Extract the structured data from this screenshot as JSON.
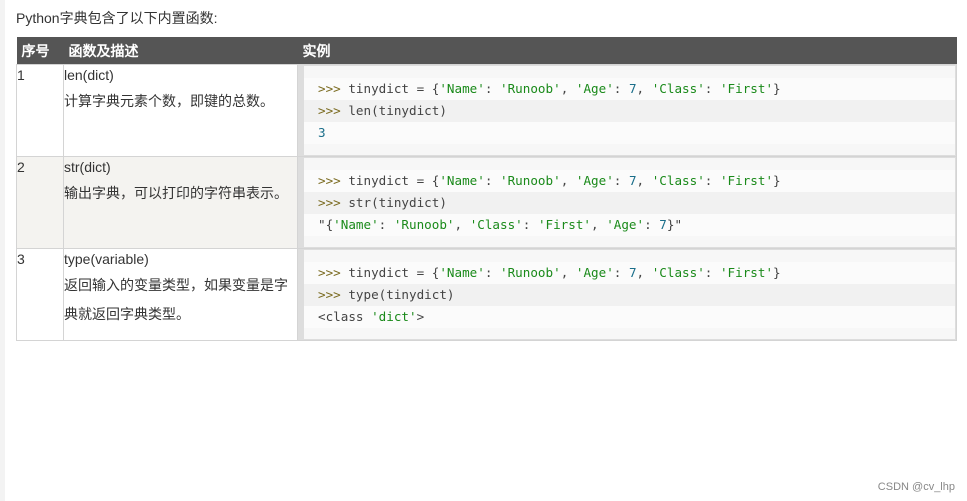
{
  "intro": "Python字典包含了以下内置函数:",
  "table": {
    "headers": [
      "序号",
      "函数及描述",
      "实例"
    ],
    "rows": [
      {
        "num": "1",
        "func": "len(dict)",
        "desc": "计算字典元素个数，即键的总数。",
        "code": [
          {
            "prompt": ">>> ",
            "code": "tinydict = {'Name': 'Runoob', 'Age': 7, 'Class': 'First'}"
          },
          {
            "prompt": ">>> ",
            "code": "len(tinydict)"
          },
          {
            "prompt": "",
            "code": "3"
          }
        ]
      },
      {
        "num": "2",
        "func": "str(dict)",
        "desc": "输出字典，可以打印的字符串表示。",
        "code": [
          {
            "prompt": ">>> ",
            "code": "tinydict = {'Name': 'Runoob', 'Age': 7, 'Class': 'First'}"
          },
          {
            "prompt": ">>> ",
            "code": "str(tinydict)"
          },
          {
            "prompt": "",
            "code": "\"{'Name': 'Runoob', 'Class': 'First', 'Age': 7}\""
          }
        ]
      },
      {
        "num": "3",
        "func": "type(variable)",
        "desc": "返回输入的变量类型，如果变量是字典就返回字典类型。",
        "code": [
          {
            "prompt": ">>> ",
            "code": "tinydict = {'Name': 'Runoob', 'Age': 7, 'Class': 'First'}"
          },
          {
            "prompt": ">>> ",
            "code": "type(tinydict)"
          },
          {
            "prompt": "",
            "code": "<class 'dict'>"
          }
        ]
      }
    ]
  },
  "watermark": "CSDN @cv_lhp",
  "colors": {
    "header_bg": "#555555",
    "alt_row_bg": "#f4f3f0",
    "string": "#1a8a1a",
    "prompt": "#7a6a1f",
    "number": "#1a6e8a"
  }
}
